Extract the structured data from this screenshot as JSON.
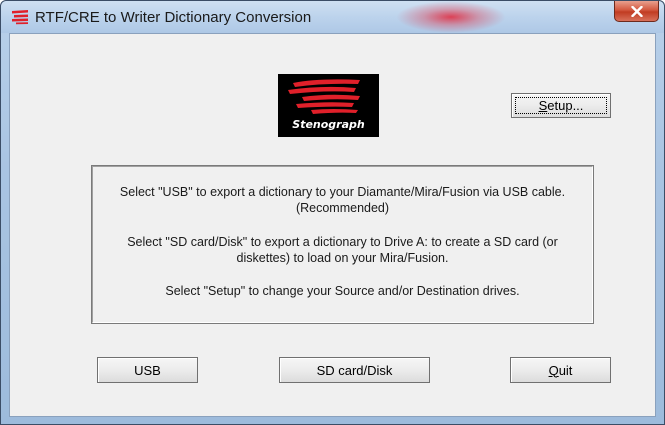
{
  "window": {
    "title": "RTF/CRE to Writer Dictionary Conversion",
    "close_label": "✕"
  },
  "logo": {
    "text": "Stenograph"
  },
  "buttons": {
    "setup_label": "Setup...",
    "usb_label": "USB",
    "sd_label": "SD card/Disk",
    "quit_label": "Quit"
  },
  "info": {
    "line1": "Select \"USB\" to export a dictionary to your Diamante/Mira/Fusion via USB cable.",
    "line1b": "(Recommended)",
    "line2": "Select \"SD card/Disk\" to export a dictionary to Drive A: to create a SD card (or",
    "line2b": "diskettes) to load on your Mira/Fusion.",
    "line3": "Select \"Setup\" to change your Source and/or Destination drives."
  },
  "colors": {
    "brand_red": "#e0202a",
    "client_bg": "#f0f0f0",
    "titlebar": "#b9d1ea",
    "close_red": "#c13c22"
  },
  "icons": {
    "app": "stenograph-logo-icon",
    "close": "close-icon"
  }
}
